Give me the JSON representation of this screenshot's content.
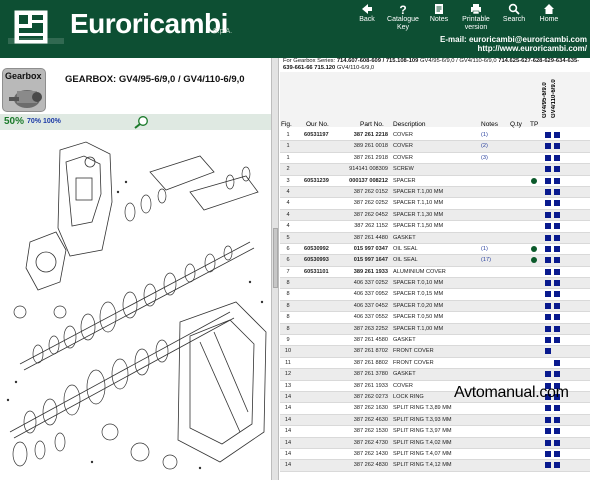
{
  "header": {
    "brand": "Euroricambi",
    "brand_sub": "S.p.A.",
    "email": "E-mail: euroricambi@euroricambi.com",
    "web": "http://www.euroricambi.com/",
    "bg_color": "#0d4f33",
    "tools": [
      {
        "label": "Back",
        "icon": "back-arrow-icon"
      },
      {
        "label": "Catalogue Key",
        "icon": "question-icon"
      },
      {
        "label": "Notes",
        "icon": "notes-icon"
      },
      {
        "label": "Printable version",
        "icon": "printer-icon"
      },
      {
        "label": "Search",
        "icon": "search-icon"
      },
      {
        "label": "Home",
        "icon": "home-icon"
      }
    ]
  },
  "left": {
    "badge_label": "Gearbox",
    "title": "GEARBOX: GV4/95-6/9,0 / GV4/110-6/9,0",
    "zoom_levels": [
      "50%",
      "70%",
      "100%"
    ]
  },
  "right": {
    "series_prefix": "For Gearbox Series:",
    "series_bold": "714.607-608-609 / 715.108-109",
    "series_rest": "GV4/95-6/9,0 / GV4/110-6/9,0",
    "series_bold2": "714.625-627-628-629-634-635-639-661-66",
    "series_bold3": "715.120",
    "series_rest2": "GV4/110-6/9,0",
    "columns": {
      "fig": "Fig.",
      "our": "Our No.",
      "part": "Part No.",
      "desc": "Description",
      "notes": "Notes",
      "qty": "Q.ty",
      "tp": "TP"
    },
    "variant_labels": [
      "GV4/95-6/9.0",
      "GV4/110-6/9.0"
    ],
    "rows": [
      {
        "fig": "1",
        "our": "60531197",
        "part": "387 261 2218",
        "part_bold": true,
        "desc": "COVER",
        "notes": "(1)",
        "tp": false,
        "v1": true,
        "v2": true
      },
      {
        "fig": "1",
        "our": "",
        "part": "389 261 0018",
        "part_bold": false,
        "desc": "COVER",
        "notes": "(2)",
        "tp": false,
        "v1": true,
        "v2": true
      },
      {
        "fig": "1",
        "our": "",
        "part": "387 261 2918",
        "part_bold": false,
        "desc": "COVER",
        "notes": "(3)",
        "tp": false,
        "v1": true,
        "v2": true
      },
      {
        "fig": "2",
        "our": "",
        "part": "914141 008309",
        "part_bold": false,
        "desc": "SCREW",
        "notes": "",
        "tp": false,
        "v1": true,
        "v2": true
      },
      {
        "fig": "3",
        "our": "60531239",
        "part": "000137 008212",
        "part_bold": true,
        "desc": "SPACER",
        "notes": "",
        "tp": true,
        "v1": true,
        "v2": true
      },
      {
        "fig": "4",
        "our": "",
        "part": "387 262 0152",
        "part_bold": false,
        "desc": "SPACER T.1,00 MM",
        "notes": "",
        "tp": false,
        "v1": true,
        "v2": true
      },
      {
        "fig": "4",
        "our": "",
        "part": "387 262 0252",
        "part_bold": false,
        "desc": "SPACER T.1,10 MM",
        "notes": "",
        "tp": false,
        "v1": true,
        "v2": true
      },
      {
        "fig": "4",
        "our": "",
        "part": "387 262 0452",
        "part_bold": false,
        "desc": "SPACER T.1,30 MM",
        "notes": "",
        "tp": false,
        "v1": true,
        "v2": true
      },
      {
        "fig": "4",
        "our": "",
        "part": "387 262 1152",
        "part_bold": false,
        "desc": "SPACER T.1,50 MM",
        "notes": "",
        "tp": false,
        "v1": true,
        "v2": true
      },
      {
        "fig": "5",
        "our": "",
        "part": "387 261 4480",
        "part_bold": false,
        "desc": "GASKET",
        "notes": "",
        "tp": false,
        "v1": true,
        "v2": true
      },
      {
        "fig": "6",
        "our": "60530992",
        "part": "015 997 0347",
        "part_bold": true,
        "desc": "OIL SEAL",
        "notes": "(1)",
        "tp": true,
        "v1": true,
        "v2": true
      },
      {
        "fig": "6",
        "our": "60530993",
        "part": "015 997 1647",
        "part_bold": true,
        "desc": "OIL SEAL",
        "notes": "(17)",
        "tp": true,
        "v1": true,
        "v2": true
      },
      {
        "fig": "7",
        "our": "60531101",
        "part": "389 261 1933",
        "part_bold": true,
        "desc": "ALUMINIUM COVER",
        "notes": "",
        "tp": false,
        "v1": true,
        "v2": true
      },
      {
        "fig": "8",
        "our": "",
        "part": "406 337 0252",
        "part_bold": false,
        "desc": "SPACER T.0,10 MM",
        "notes": "",
        "tp": false,
        "v1": true,
        "v2": true
      },
      {
        "fig": "8",
        "our": "",
        "part": "406 337 0952",
        "part_bold": false,
        "desc": "SPACER T.0,15 MM",
        "notes": "",
        "tp": false,
        "v1": true,
        "v2": true
      },
      {
        "fig": "8",
        "our": "",
        "part": "406 337 0452",
        "part_bold": false,
        "desc": "SPACER T.0,20 MM",
        "notes": "",
        "tp": false,
        "v1": true,
        "v2": true
      },
      {
        "fig": "8",
        "our": "",
        "part": "406 337 0552",
        "part_bold": false,
        "desc": "SPACER T.0,50 MM",
        "notes": "",
        "tp": false,
        "v1": true,
        "v2": true
      },
      {
        "fig": "8",
        "our": "",
        "part": "387 263 2252",
        "part_bold": false,
        "desc": "SPACER T.1,00 MM",
        "notes": "",
        "tp": false,
        "v1": true,
        "v2": true
      },
      {
        "fig": "9",
        "our": "",
        "part": "387 261 4580",
        "part_bold": false,
        "desc": "GASKET",
        "notes": "",
        "tp": false,
        "v1": true,
        "v2": true
      },
      {
        "fig": "10",
        "our": "",
        "part": "387 261 8702",
        "part_bold": false,
        "desc": "FRONT COVER",
        "notes": "",
        "tp": false,
        "v1": true,
        "v2": false
      },
      {
        "fig": "11",
        "our": "",
        "part": "387 261 8802",
        "part_bold": false,
        "desc": "FRONT COVER",
        "notes": "",
        "tp": false,
        "v1": false,
        "v2": true
      },
      {
        "fig": "12",
        "our": "",
        "part": "387 261 3780",
        "part_bold": false,
        "desc": "GASKET",
        "notes": "",
        "tp": false,
        "v1": true,
        "v2": true
      },
      {
        "fig": "13",
        "our": "",
        "part": "387 261 1933",
        "part_bold": false,
        "desc": "COVER",
        "notes": "",
        "tp": false,
        "v1": true,
        "v2": true
      },
      {
        "fig": "14",
        "our": "",
        "part": "387 262 0273",
        "part_bold": false,
        "desc": "LOCK RING",
        "notes": "",
        "tp": false,
        "v1": true,
        "v2": true
      },
      {
        "fig": "14",
        "our": "",
        "part": "387 262 1630",
        "part_bold": false,
        "desc": "SPLIT RING T.3,89 MM",
        "notes": "",
        "tp": false,
        "v1": true,
        "v2": true
      },
      {
        "fig": "14",
        "our": "",
        "part": "387 262 4630",
        "part_bold": false,
        "desc": "SPLIT RING T.3,93 MM",
        "notes": "",
        "tp": false,
        "v1": true,
        "v2": true
      },
      {
        "fig": "14",
        "our": "",
        "part": "387 262 1530",
        "part_bold": false,
        "desc": "SPLIT RING T.3,97 MM",
        "notes": "",
        "tp": false,
        "v1": true,
        "v2": true
      },
      {
        "fig": "14",
        "our": "",
        "part": "387 262 4730",
        "part_bold": false,
        "desc": "SPLIT RING T.4,02 MM",
        "notes": "",
        "tp": false,
        "v1": true,
        "v2": true
      },
      {
        "fig": "14",
        "our": "",
        "part": "387 262 1430",
        "part_bold": false,
        "desc": "SPLIT RING T.4,07 MM",
        "notes": "",
        "tp": false,
        "v1": true,
        "v2": true
      },
      {
        "fig": "14",
        "our": "",
        "part": "387 262 4830",
        "part_bold": false,
        "desc": "SPLIT RING T.4,12 MM",
        "notes": "",
        "tp": false,
        "v1": true,
        "v2": true
      }
    ]
  },
  "watermark": "Avtomanual.com"
}
